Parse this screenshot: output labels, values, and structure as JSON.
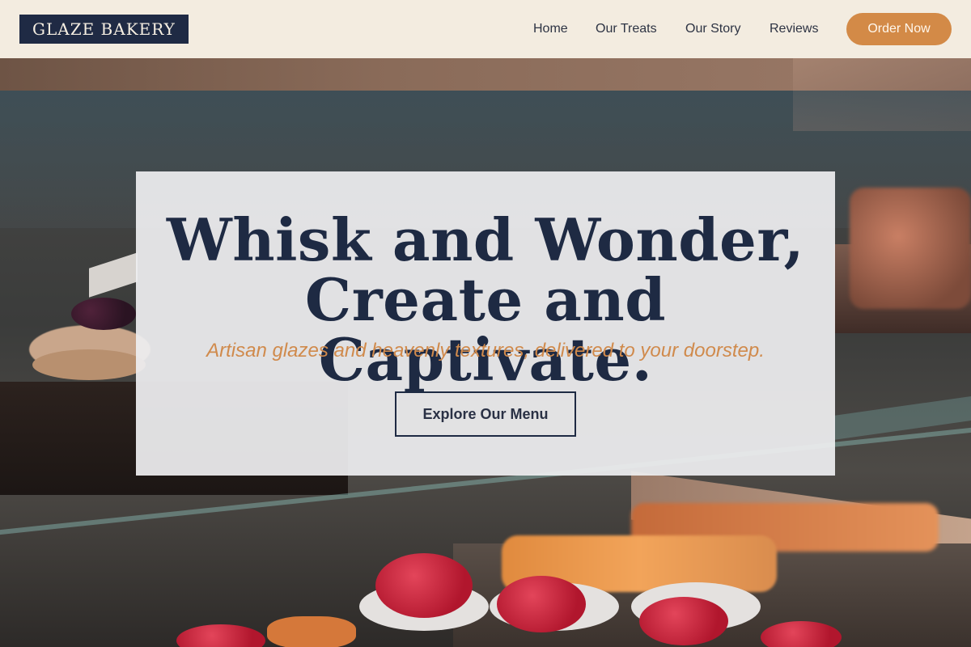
{
  "header": {
    "logo_text": "GLAZE BAKERY",
    "nav": [
      "Home",
      "Our Treats",
      "Our Story",
      "Reviews"
    ],
    "cta_label": "Order Now"
  },
  "hero": {
    "headline_line1": "Whisk and Wonder,",
    "headline_line2": "Create and Captivate.",
    "tagline": "Artisan glazes and heavenly textures, delivered to your doorstep.",
    "button_label": "Explore Our Menu",
    "background_image": "bakery-display-case-photo"
  },
  "colors": {
    "navy": "#1f2a44",
    "accent_orange": "#d38a47",
    "header_bg": "#f3ece0"
  }
}
